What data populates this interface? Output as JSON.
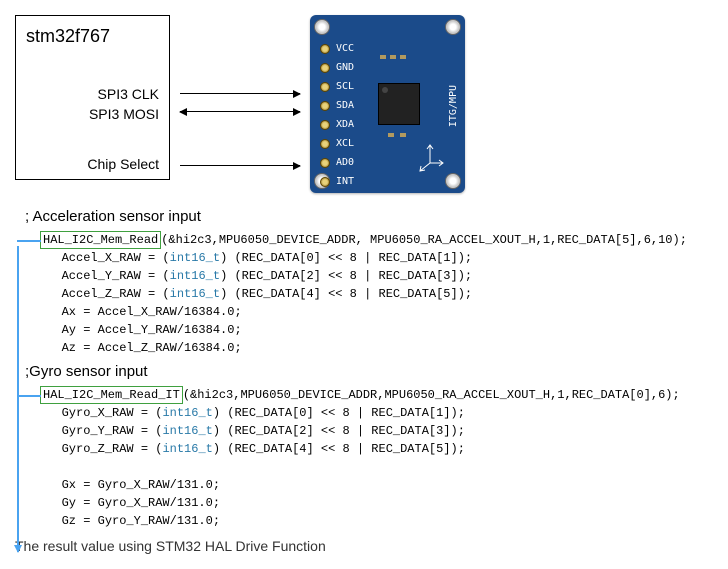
{
  "mcu": {
    "title": "stm32f767",
    "signals": {
      "clk": "SPI3 CLK",
      "mosi": "SPI3 MOSI",
      "cs": "Chip Select"
    }
  },
  "board": {
    "pins": [
      "VCC",
      "GND",
      "SCL",
      "SDA",
      "XDA",
      "XCL",
      "AD0",
      "INT"
    ],
    "silk": "ITG/MPU"
  },
  "accel": {
    "title": "; Acceleration sensor input",
    "fn": "HAL_I2C_Mem_Read",
    "args": "(&hi2c3,MPU6050_DEVICE_ADDR, MPU6050_RA_ACCEL_XOUT_H,1,REC_DATA[5],6,10);",
    "cast": "int16_t",
    "lines": [
      "Accel_X_RAW = (",
      ") (REC_DATA[0] << 8 | REC_DATA[1]);",
      "Accel_Y_RAW = (",
      ") (REC_DATA[2] << 8 | REC_DATA[3]);",
      "Accel_Z_RAW = (",
      ") (REC_DATA[4] << 8 | REC_DATA[5]);"
    ],
    "calc": [
      "Ax = Accel_X_RAW/16384.0;",
      "Ay = Accel_Y_RAW/16384.0;",
      "Az = Accel_Z_RAW/16384.0;"
    ]
  },
  "gyro": {
    "title": ";Gyro sensor input",
    "fn": "HAL_I2C_Mem_Read_IT",
    "args": "(&hi2c3,MPU6050_DEVICE_ADDR,MPU6050_RA_ACCEL_XOUT_H,1,REC_DATA[0],6);",
    "cast": "int16_t",
    "lines": [
      "Gyro_X_RAW = (",
      ") (REC_DATA[0] << 8 | REC_DATA[1]);",
      "Gyro_Y_RAW = (",
      ") (REC_DATA[2] << 8 | REC_DATA[3]);",
      "Gyro_Z_RAW = (",
      ") (REC_DATA[4] << 8 | REC_DATA[5]);"
    ],
    "calc": [
      "Gx = Gyro_X_RAW/131.0;",
      "Gy = Gyro_X_RAW/131.0;",
      "Gz = Gyro_Y_RAW/131.0;"
    ]
  },
  "result": "The result value using STM32 HAL Drive Function"
}
